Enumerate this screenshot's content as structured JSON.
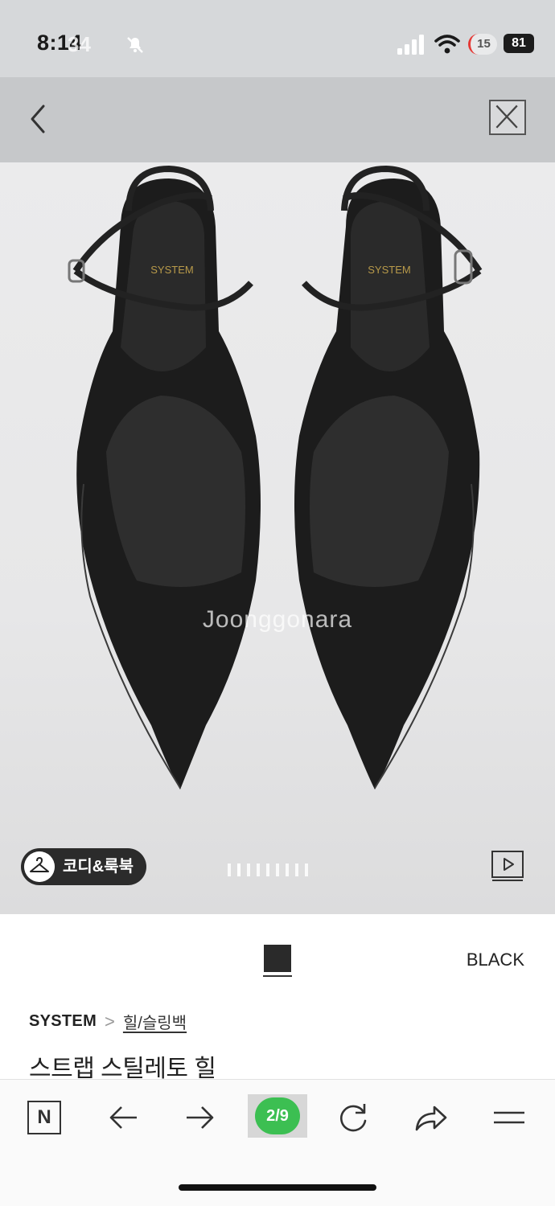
{
  "status_bar": {
    "time": "8:14",
    "time_overlay": "34",
    "record_label": "15",
    "battery": "81"
  },
  "product": {
    "watermark": "Joonggonara",
    "coordi_label": "코디&룩북",
    "color_name": "BLACK",
    "swatch_color": "#2a2a2a",
    "brand": "SYSTEM",
    "breadcrumb_separator": ">",
    "category": "힐/슬링백",
    "title": "스트랩 스틸레토 힐",
    "insole_brand": "SYSTEM",
    "image_count": 9,
    "current_image": 2
  },
  "browser": {
    "logo": "N",
    "tab_counter": "2/9",
    "accent_color": "#3cbf52"
  }
}
